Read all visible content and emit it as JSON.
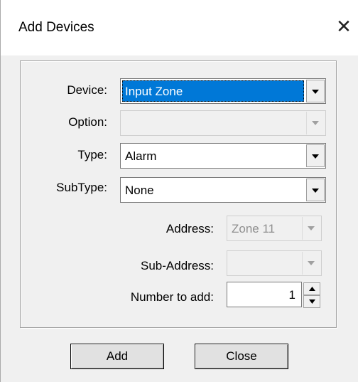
{
  "window": {
    "title": "Add Devices",
    "close_glyph": "✕"
  },
  "form": {
    "device": {
      "label": "Device:",
      "value": "Input Zone",
      "enabled": true,
      "selected": true
    },
    "option": {
      "label": "Option:",
      "value": "",
      "enabled": false
    },
    "type": {
      "label": "Type:",
      "value": "Alarm",
      "enabled": true
    },
    "subtype": {
      "label": "SubType:",
      "value": "None",
      "enabled": true
    },
    "address": {
      "label": "Address:",
      "value": "Zone 11",
      "enabled": false
    },
    "sub_address": {
      "label": "Sub-Address:",
      "value": "",
      "enabled": false
    },
    "number_to_add": {
      "label": "Number to add:",
      "value": "1"
    }
  },
  "buttons": {
    "add": "Add",
    "close": "Close"
  },
  "icons": {
    "dropdown": "chevron-down-icon",
    "spin_up": "arrow-up-icon",
    "spin_down": "arrow-down-icon",
    "close": "close-icon"
  },
  "colors": {
    "selection": "#0078d7",
    "dialog_bg": "#f0f0f0",
    "title_bg": "#ffffff"
  }
}
